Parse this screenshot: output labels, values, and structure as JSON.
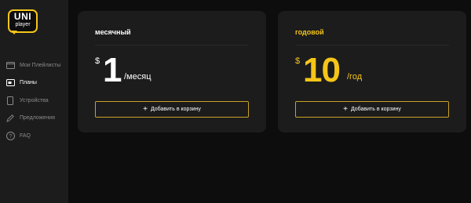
{
  "logo": {
    "line1": "UNI",
    "line2": "player"
  },
  "nav": [
    {
      "label": "Мои Плейлисты",
      "icon": "folder-icon",
      "active": false
    },
    {
      "label": "Планы",
      "icon": "card-icon",
      "active": true
    },
    {
      "label": "Устройства",
      "icon": "phone-icon",
      "active": false
    },
    {
      "label": "Предложения",
      "icon": "pencil-icon",
      "active": false
    },
    {
      "label": "FAQ",
      "icon": "question-icon",
      "active": false
    }
  ],
  "plans": [
    {
      "title": "месячный",
      "currency": "$",
      "amount": "1",
      "period": "/месяц",
      "button": "Добавить в корзину",
      "accent": "#ffffff"
    },
    {
      "title": "годовой",
      "currency": "$",
      "amount": "10",
      "period": "/год",
      "button": "Добавить в корзину",
      "accent": "#f5c518"
    }
  ],
  "colors": {
    "accent": "#f5c518",
    "sidebar": "#1c1c1c",
    "card": "#1c1c1c",
    "background": "#0d0d0d"
  }
}
